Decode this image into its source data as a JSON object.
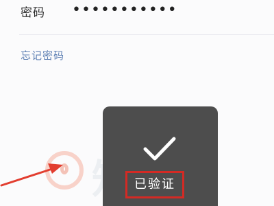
{
  "login_form": {
    "password_label": "密码",
    "password_value": "•••••••••••",
    "forgot_password_link": "忘记密码"
  },
  "toast": {
    "message": "已验证",
    "icon": "checkmark-icon"
  },
  "watermark": {
    "text": "知百科"
  },
  "annotations": {
    "arrow_color": "#e23d2f",
    "highlight_color": "#d42a24"
  }
}
